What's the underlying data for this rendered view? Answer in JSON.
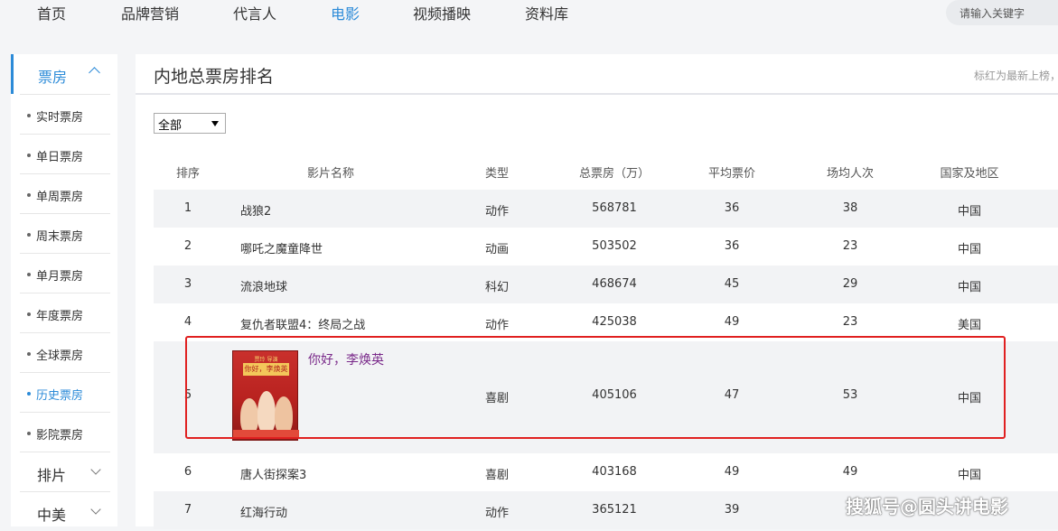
{
  "nav": {
    "items": [
      "首页",
      "品牌营销",
      "代言人",
      "电影",
      "视频播映",
      "资料库"
    ],
    "active_index": 3,
    "search_placeholder": "请输入关键字"
  },
  "sidebar": {
    "section_label": "票房",
    "items": [
      "实时票房",
      "单日票房",
      "单周票房",
      "周末票房",
      "单月票房",
      "年度票房",
      "全球票房",
      "历史票房",
      "影院票房"
    ],
    "active_index": 7,
    "groups": [
      "排片",
      "中美"
    ]
  },
  "main": {
    "title": "内地总票房排名",
    "note": "标红为最新上榜，",
    "filter_value": "全部"
  },
  "table": {
    "headers": {
      "rank": "排序",
      "title": "影片名称",
      "genre": "类型",
      "gross": "总票房（万）",
      "price": "平均票价",
      "avg": "场均人次",
      "region": "国家及地区"
    },
    "rows": [
      {
        "rank": "1",
        "title": "战狼2",
        "genre": "动作",
        "gross": "568781",
        "price": "36",
        "avg": "38",
        "region": "中国"
      },
      {
        "rank": "2",
        "title": "哪吒之魔童降世",
        "genre": "动画",
        "gross": "503502",
        "price": "36",
        "avg": "23",
        "region": "中国"
      },
      {
        "rank": "3",
        "title": "流浪地球",
        "genre": "科幻",
        "gross": "468674",
        "price": "45",
        "avg": "29",
        "region": "中国"
      },
      {
        "rank": "4",
        "title": "复仇者联盟4：终局之战",
        "genre": "动作",
        "gross": "425038",
        "price": "49",
        "avg": "23",
        "region": "美国"
      },
      {
        "rank": "5",
        "title": "你好，李焕英",
        "genre": "喜剧",
        "gross": "405106",
        "price": "47",
        "avg": "53",
        "region": "中国",
        "poster_text": "你好，李焕英",
        "poster_top": "贾玲 导演"
      },
      {
        "rank": "6",
        "title": "唐人街探案3",
        "genre": "喜剧",
        "gross": "403168",
        "price": "49",
        "avg": "49",
        "region": "中国"
      },
      {
        "rank": "7",
        "title": "红海行动",
        "genre": "动作",
        "gross": "365121",
        "price": "39",
        "avg": "",
        "region": ""
      }
    ]
  },
  "watermark": "搜狐号@圆头讲电影",
  "colors": {
    "accent": "#2c8bd8",
    "highlight_frame": "#e02020",
    "new_title": "#7a2a8a"
  }
}
